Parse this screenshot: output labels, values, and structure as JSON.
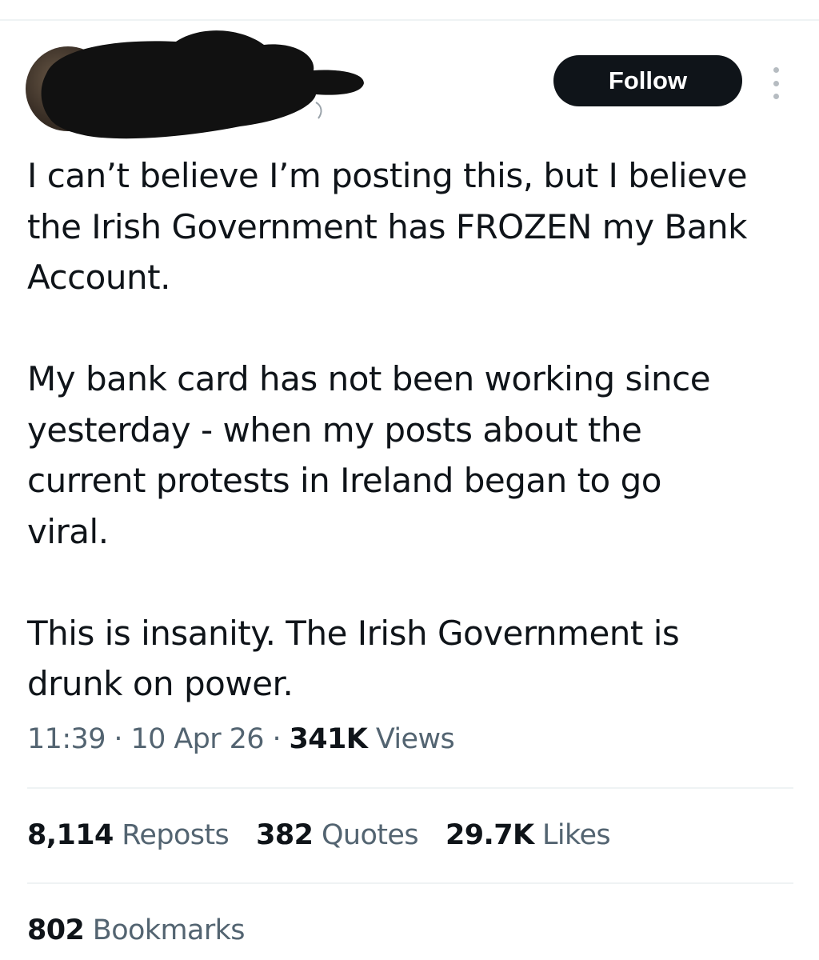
{
  "header": {
    "follow_label": "Follow"
  },
  "tweet": {
    "paragraphs": [
      "I can’t believe I’m posting this, but I believe\nthe Irish Government has FROZEN my Bank\nAccount.",
      "My bank card has not been working since\nyesterday - when my posts about the\ncurrent protests in Ireland began to go\nviral.",
      "This is insanity. The Irish Government is\ndrunk on power."
    ],
    "time": "11:39",
    "date": "10 Apr 26",
    "separator": "·",
    "views_count": "341K",
    "views_label": "Views"
  },
  "stats": {
    "reposts_count": "8,114",
    "reposts_label": "Reposts",
    "quotes_count": "382",
    "quotes_label": "Quotes",
    "likes_count": "29.7K",
    "likes_label": "Likes",
    "bookmarks_count": "802",
    "bookmarks_label": "Bookmarks"
  },
  "icons": {
    "more": "more-vertical-icon"
  },
  "colors": {
    "text_primary": "#0f1419",
    "text_secondary": "#536471",
    "follow_button_bg": "#0f1419",
    "follow_button_text": "#ffffff",
    "divider": "#eff3f4"
  }
}
